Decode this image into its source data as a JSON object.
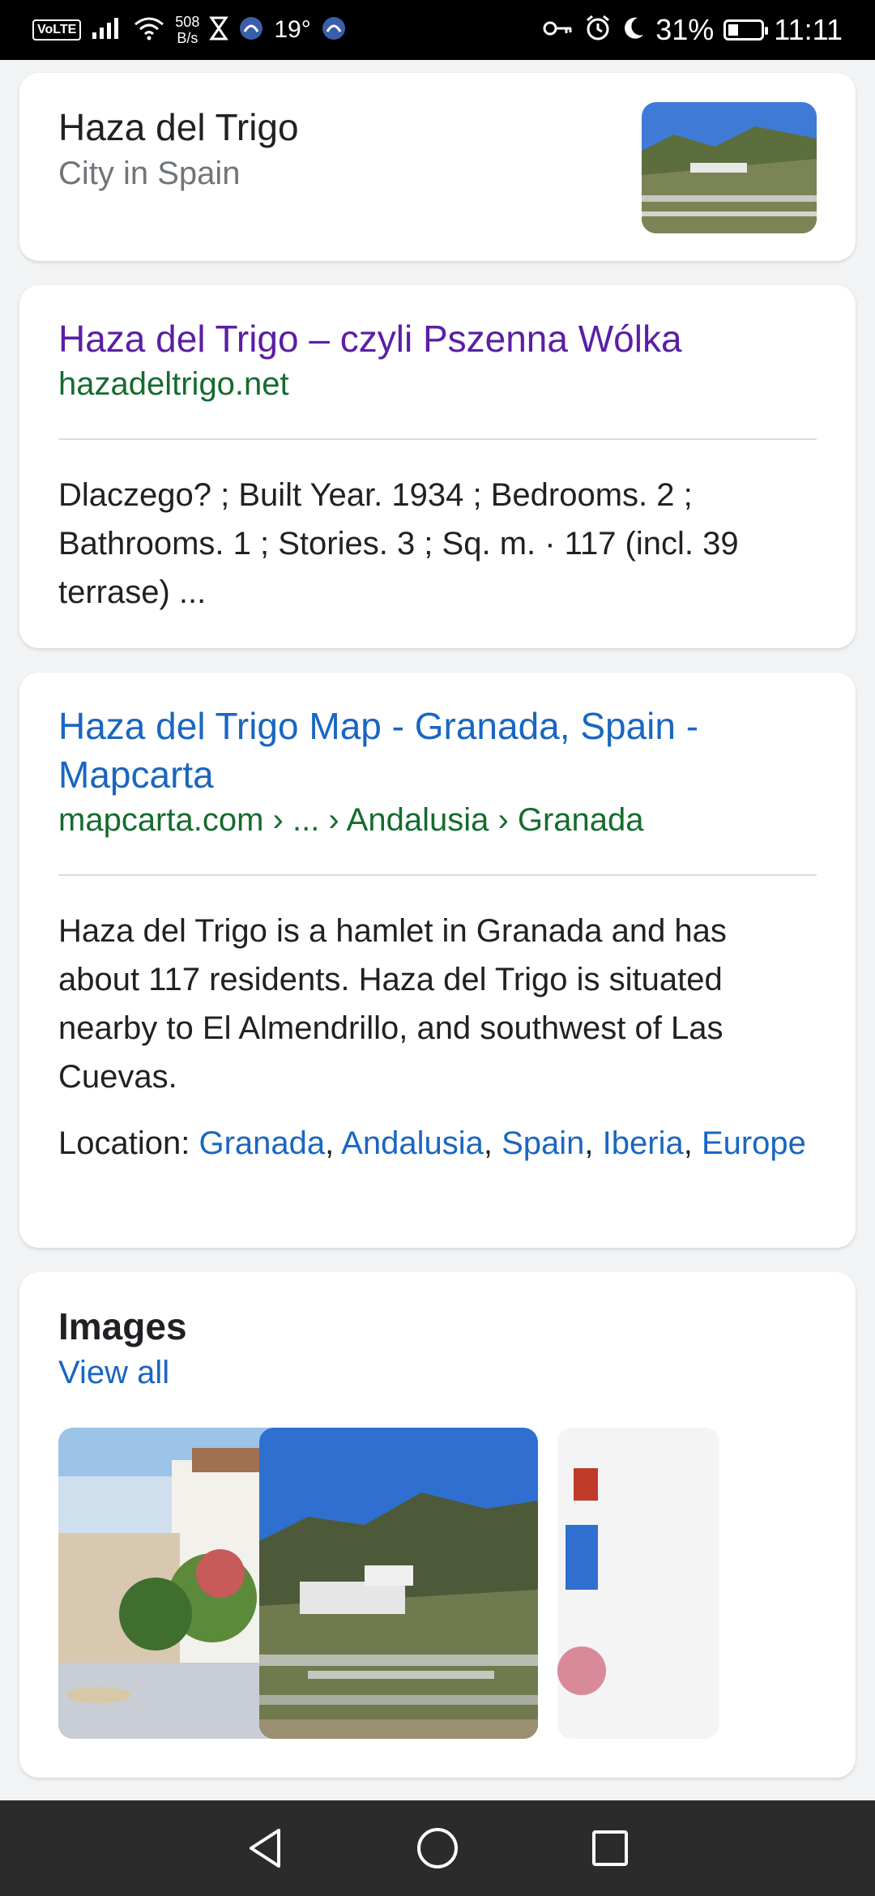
{
  "status_bar": {
    "volte": "VoLTE",
    "net_speed_value": "508",
    "net_speed_unit": "B/s",
    "temperature": "19°",
    "battery": "31%",
    "time": "11:11",
    "battery_level": 0.31
  },
  "entity_card": {
    "title": "Haza del Trigo",
    "subtitle": "City in Spain"
  },
  "result1": {
    "title": "Haza del Trigo – czyli Pszenna Wólka",
    "url": "hazadeltrigo.net",
    "snippet": "Dlaczego? ; Built Year. 1934 ; Bedrooms. 2 ; Bathrooms. 1 ; Stories. 3 ; Sq. m. · 117 (incl. 39 terrase) ..."
  },
  "result2": {
    "title": "Haza del Trigo Map - Granada, Spain - Mapcarta",
    "url": "mapcarta.com › ... › Andalusia › Granada",
    "snippet": "Haza del Trigo is a hamlet in Granada and has about 117 residents. Haza del Trigo is situated nearby to El Almendrillo, and southwest of Las Cuevas.",
    "location_label": "Location: ",
    "location_links": [
      "Granada",
      "Andalusia",
      "Spain",
      "Iberia",
      "Europe"
    ],
    "separator": ", "
  },
  "images_card": {
    "title": "Images",
    "view_all": "View all"
  },
  "colors": {
    "visited_link": "#5a1fa3",
    "link": "#1a66c1",
    "url_green": "#146c2e",
    "navbar_bg": "#2b2b2b"
  }
}
